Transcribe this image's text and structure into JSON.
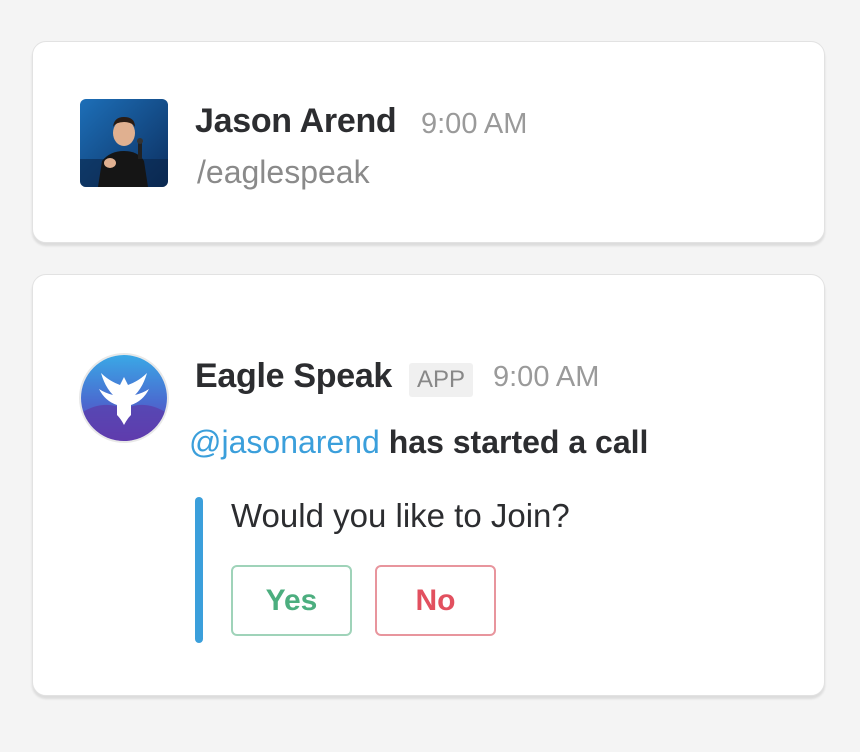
{
  "message_1": {
    "user_name": "Jason Arend",
    "time": "9:00 AM",
    "command": "/eaglespeak",
    "avatar": "user-photo"
  },
  "message_2": {
    "app_name": "Eagle Speak",
    "badge": "APP",
    "time": "9:00 AM",
    "avatar": "eagle-logo-icon",
    "mention": "@jasonarend",
    "text": " has started a call",
    "attachment": {
      "question": "Would you like to Join?",
      "accent_color": "#3b9fdb",
      "buttons": [
        {
          "label": "Yes",
          "color": "#4cae7f"
        },
        {
          "label": "No",
          "color": "#e2505f"
        }
      ]
    }
  }
}
